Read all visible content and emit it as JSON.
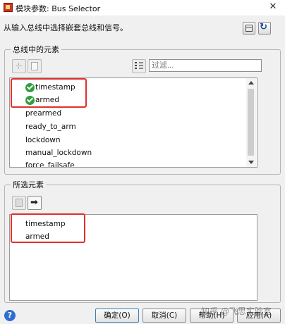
{
  "window": {
    "title": "模块参数: Bus Selector",
    "close_glyph": "✕"
  },
  "description": "从输入总线中选择嵌套总线和信号。",
  "toolbar_icons": [
    "grid-icon",
    "refresh-icon"
  ],
  "bus_elements": {
    "legend": "总线中的元素",
    "filter": {
      "value": "",
      "placeholder": "过滤..."
    },
    "items": [
      {
        "label": "timestamp",
        "selected": true
      },
      {
        "label": "armed",
        "selected": true
      },
      {
        "label": "prearmed",
        "selected": false
      },
      {
        "label": "ready_to_arm",
        "selected": false
      },
      {
        "label": "lockdown",
        "selected": false
      },
      {
        "label": "manual_lockdown",
        "selected": false
      },
      {
        "label": "force_failsafe",
        "selected": false
      }
    ]
  },
  "selected_elements": {
    "legend": "所选元素",
    "items": [
      "timestamp",
      "armed"
    ]
  },
  "buttons": {
    "ok": "确定(O)",
    "cancel": "取消(C)",
    "help": "帮助(H)",
    "apply": "应用(A)"
  },
  "help_glyph": "?",
  "watermark": "知乎 @飞思实验室",
  "colors": {
    "highlight_box": "#e0302b",
    "check": "#2e9e3e",
    "help": "#2f6ed0"
  }
}
